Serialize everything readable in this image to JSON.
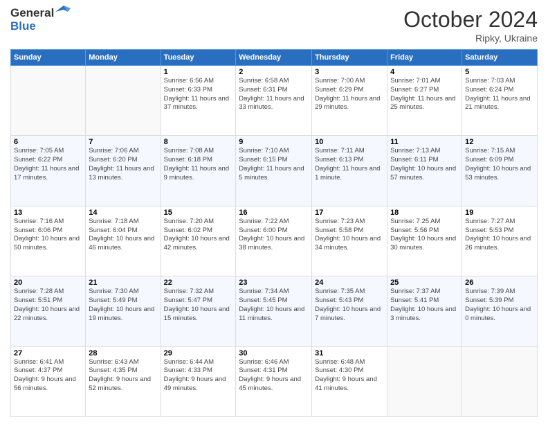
{
  "header": {
    "logo_line1": "General",
    "logo_line2": "Blue",
    "month": "October 2024",
    "location": "Ripky, Ukraine"
  },
  "weekdays": [
    "Sunday",
    "Monday",
    "Tuesday",
    "Wednesday",
    "Thursday",
    "Friday",
    "Saturday"
  ],
  "weeks": [
    [
      {
        "day": "",
        "info": ""
      },
      {
        "day": "",
        "info": ""
      },
      {
        "day": "1",
        "info": "Sunrise: 6:56 AM\nSunset: 6:33 PM\nDaylight: 11 hours and 37 minutes."
      },
      {
        "day": "2",
        "info": "Sunrise: 6:58 AM\nSunset: 6:31 PM\nDaylight: 11 hours and 33 minutes."
      },
      {
        "day": "3",
        "info": "Sunrise: 7:00 AM\nSunset: 6:29 PM\nDaylight: 11 hours and 29 minutes."
      },
      {
        "day": "4",
        "info": "Sunrise: 7:01 AM\nSunset: 6:27 PM\nDaylight: 11 hours and 25 minutes."
      },
      {
        "day": "5",
        "info": "Sunrise: 7:03 AM\nSunset: 6:24 PM\nDaylight: 11 hours and 21 minutes."
      }
    ],
    [
      {
        "day": "6",
        "info": "Sunrise: 7:05 AM\nSunset: 6:22 PM\nDaylight: 11 hours and 17 minutes."
      },
      {
        "day": "7",
        "info": "Sunrise: 7:06 AM\nSunset: 6:20 PM\nDaylight: 11 hours and 13 minutes."
      },
      {
        "day": "8",
        "info": "Sunrise: 7:08 AM\nSunset: 6:18 PM\nDaylight: 11 hours and 9 minutes."
      },
      {
        "day": "9",
        "info": "Sunrise: 7:10 AM\nSunset: 6:15 PM\nDaylight: 11 hours and 5 minutes."
      },
      {
        "day": "10",
        "info": "Sunrise: 7:11 AM\nSunset: 6:13 PM\nDaylight: 11 hours and 1 minute."
      },
      {
        "day": "11",
        "info": "Sunrise: 7:13 AM\nSunset: 6:11 PM\nDaylight: 10 hours and 57 minutes."
      },
      {
        "day": "12",
        "info": "Sunrise: 7:15 AM\nSunset: 6:09 PM\nDaylight: 10 hours and 53 minutes."
      }
    ],
    [
      {
        "day": "13",
        "info": "Sunrise: 7:16 AM\nSunset: 6:06 PM\nDaylight: 10 hours and 50 minutes."
      },
      {
        "day": "14",
        "info": "Sunrise: 7:18 AM\nSunset: 6:04 PM\nDaylight: 10 hours and 46 minutes."
      },
      {
        "day": "15",
        "info": "Sunrise: 7:20 AM\nSunset: 6:02 PM\nDaylight: 10 hours and 42 minutes."
      },
      {
        "day": "16",
        "info": "Sunrise: 7:22 AM\nSunset: 6:00 PM\nDaylight: 10 hours and 38 minutes."
      },
      {
        "day": "17",
        "info": "Sunrise: 7:23 AM\nSunset: 5:58 PM\nDaylight: 10 hours and 34 minutes."
      },
      {
        "day": "18",
        "info": "Sunrise: 7:25 AM\nSunset: 5:56 PM\nDaylight: 10 hours and 30 minutes."
      },
      {
        "day": "19",
        "info": "Sunrise: 7:27 AM\nSunset: 5:53 PM\nDaylight: 10 hours and 26 minutes."
      }
    ],
    [
      {
        "day": "20",
        "info": "Sunrise: 7:28 AM\nSunset: 5:51 PM\nDaylight: 10 hours and 22 minutes."
      },
      {
        "day": "21",
        "info": "Sunrise: 7:30 AM\nSunset: 5:49 PM\nDaylight: 10 hours and 19 minutes."
      },
      {
        "day": "22",
        "info": "Sunrise: 7:32 AM\nSunset: 5:47 PM\nDaylight: 10 hours and 15 minutes."
      },
      {
        "day": "23",
        "info": "Sunrise: 7:34 AM\nSunset: 5:45 PM\nDaylight: 10 hours and 11 minutes."
      },
      {
        "day": "24",
        "info": "Sunrise: 7:35 AM\nSunset: 5:43 PM\nDaylight: 10 hours and 7 minutes."
      },
      {
        "day": "25",
        "info": "Sunrise: 7:37 AM\nSunset: 5:41 PM\nDaylight: 10 hours and 3 minutes."
      },
      {
        "day": "26",
        "info": "Sunrise: 7:39 AM\nSunset: 5:39 PM\nDaylight: 10 hours and 0 minutes."
      }
    ],
    [
      {
        "day": "27",
        "info": "Sunrise: 6:41 AM\nSunset: 4:37 PM\nDaylight: 9 hours and 56 minutes."
      },
      {
        "day": "28",
        "info": "Sunrise: 6:43 AM\nSunset: 4:35 PM\nDaylight: 9 hours and 52 minutes."
      },
      {
        "day": "29",
        "info": "Sunrise: 6:44 AM\nSunset: 4:33 PM\nDaylight: 9 hours and 49 minutes."
      },
      {
        "day": "30",
        "info": "Sunrise: 6:46 AM\nSunset: 4:31 PM\nDaylight: 9 hours and 45 minutes."
      },
      {
        "day": "31",
        "info": "Sunrise: 6:48 AM\nSunset: 4:30 PM\nDaylight: 9 hours and 41 minutes."
      },
      {
        "day": "",
        "info": ""
      },
      {
        "day": "",
        "info": ""
      }
    ]
  ]
}
